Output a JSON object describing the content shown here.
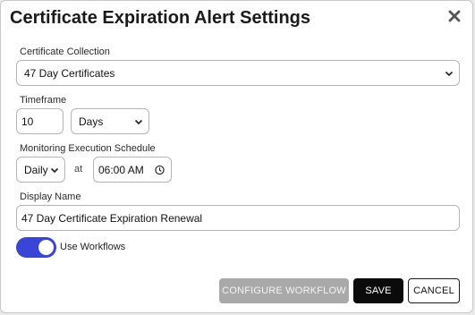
{
  "dialog": {
    "title": "Certificate Expiration Alert Settings",
    "close_icon": "close-icon"
  },
  "collection": {
    "label": "Certificate Collection",
    "value": "47 Day Certificates"
  },
  "timeframe": {
    "label": "Timeframe",
    "amount": "10",
    "unit": "Days"
  },
  "schedule": {
    "label": "Monitoring Execution Schedule",
    "frequency": "Daily",
    "at_label": "at",
    "time": "06:00 AM"
  },
  "display_name": {
    "label": "Display Name",
    "value": "47 Day Certificate Expiration Renewal"
  },
  "workflows": {
    "label": "Use Workflows",
    "enabled": true
  },
  "buttons": {
    "configure": "CONFIGURE WORKFLOW",
    "save": "SAVE",
    "cancel": "CANCEL"
  },
  "colors": {
    "toggle_on": "#3845d6",
    "save_bg": "#0b0b0b",
    "configure_disabled": "#a9a9a9"
  }
}
